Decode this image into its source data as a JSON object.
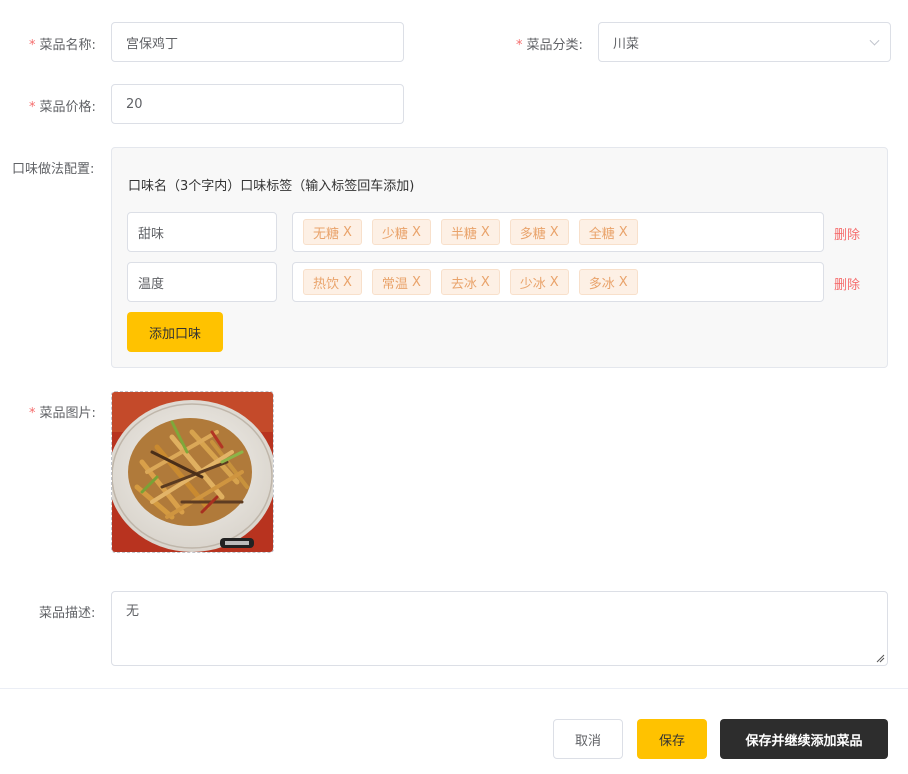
{
  "form": {
    "name": {
      "label": "菜品名称:",
      "required": true,
      "value": "宫保鸡丁"
    },
    "category": {
      "label": "菜品分类:",
      "required": true,
      "value": "川菜"
    },
    "price": {
      "label": "菜品价格:",
      "required": true,
      "value": "20"
    },
    "flavors": {
      "label": "口味做法配置:",
      "header": "口味名（3个字内）口味标签（输入标签回车添加)",
      "rows": [
        {
          "name": "甜味",
          "tags": [
            "无糖",
            "少糖",
            "半糖",
            "多糖",
            "全糖"
          ],
          "delete_label": "删除"
        },
        {
          "name": "温度",
          "tags": [
            "热饮",
            "常温",
            "去冰",
            "少冰",
            "多冰"
          ],
          "delete_label": "删除"
        }
      ],
      "add_label": "添加口味",
      "tag_remove_glyph": "X"
    },
    "image": {
      "label": "菜品图片:",
      "required": true
    },
    "description": {
      "label": "菜品描述:",
      "value": "无"
    }
  },
  "footer": {
    "cancel_label": "取消",
    "save_label": "保存",
    "save_continue_label": "保存并继续添加菜品"
  },
  "colors": {
    "accent": "#ffc200",
    "danger": "#f56c6c",
    "tag_text": "#e9a36b",
    "dark_button": "#2d2d2d"
  }
}
